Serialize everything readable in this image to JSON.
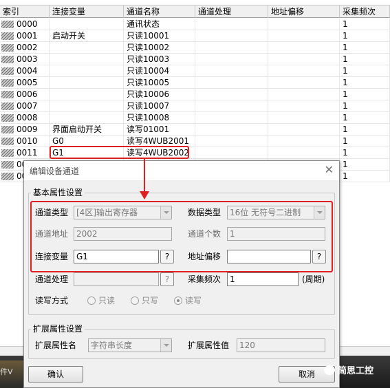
{
  "grid": {
    "columns": [
      "索引",
      "连接变量",
      "通道名称",
      "通道处理",
      "地址偏移",
      "采集频次"
    ],
    "rows": [
      {
        "index": "0000",
        "var": "",
        "name": "通讯状态",
        "freq": "1"
      },
      {
        "index": "0001",
        "var": "启动开关",
        "name": "只读10001",
        "freq": "1"
      },
      {
        "index": "0002",
        "var": "",
        "name": "只读10002",
        "freq": "1"
      },
      {
        "index": "0003",
        "var": "",
        "name": "只读10003",
        "freq": "1"
      },
      {
        "index": "0004",
        "var": "",
        "name": "只读10004",
        "freq": "1"
      },
      {
        "index": "0005",
        "var": "",
        "name": "只读10005",
        "freq": "1"
      },
      {
        "index": "0006",
        "var": "",
        "name": "只读10006",
        "freq": "1"
      },
      {
        "index": "0007",
        "var": "",
        "name": "只读10007",
        "freq": "1"
      },
      {
        "index": "0008",
        "var": "",
        "name": "只读10008",
        "freq": "1"
      },
      {
        "index": "0009",
        "var": "界面启动开关",
        "name": "读写01001",
        "freq": "1"
      },
      {
        "index": "0010",
        "var": "G0",
        "name": "读写4WUB2001",
        "freq": "1"
      },
      {
        "index": "0011",
        "var": "G1",
        "name": "读写4WUB2002",
        "freq": "1"
      },
      {
        "index": "00",
        "var": "",
        "name": "",
        "freq": "1"
      },
      {
        "index": "00",
        "var": "",
        "name": "",
        "freq": "1"
      }
    ]
  },
  "dialog": {
    "title": "编辑设备通道",
    "basic_group": "基本属性设置",
    "channel_type_label": "通道类型",
    "channel_type_value": "[4区]输出寄存器",
    "data_type_label": "数据类型",
    "data_type_value": "16位 无符号二进制",
    "channel_addr_label": "通道地址",
    "channel_addr_value": "2002",
    "channel_count_label": "通道个数",
    "channel_count_value": "1",
    "link_var_label": "连接变量",
    "link_var_value": "G1",
    "addr_offset_label": "地址偏移",
    "addr_offset_value": "",
    "channel_proc_label": "通道处理",
    "channel_proc_value": "",
    "sample_freq_label": "采集频次",
    "sample_freq_value": "1",
    "period_label": "(周期)",
    "rw_label": "读写方式",
    "rw_options": [
      "只读",
      "只写",
      "读写"
    ],
    "rw_selected": "读写",
    "ext_group": "扩展属性设置",
    "ext_name_label": "扩展属性名",
    "ext_name_value": "字符串长度",
    "ext_value_label": "扩展属性值",
    "ext_value_value": "120",
    "browse_label": "?",
    "ok_label": "确认",
    "cancel_label": "取消"
  },
  "taskbar": {
    "left_text": "件V",
    "watermark": "简思工控"
  },
  "colors": {
    "highlight": "#e02020"
  }
}
